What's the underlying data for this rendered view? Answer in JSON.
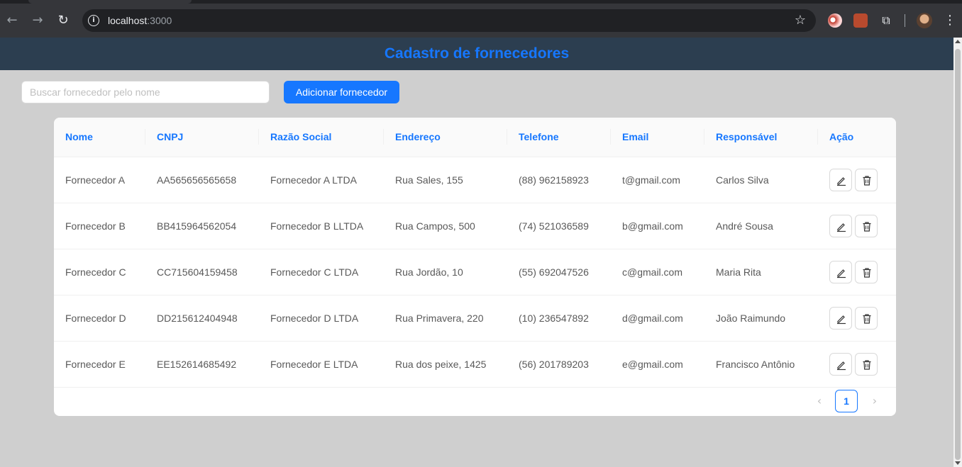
{
  "browser": {
    "url_host": "localhost",
    "url_port": ":3000"
  },
  "header": {
    "title": "Cadastro de fornecedores"
  },
  "toolbar": {
    "search_placeholder": "Buscar fornecedor pelo nome",
    "search_value": "",
    "add_label": "Adicionar fornecedor"
  },
  "table": {
    "columns": [
      "Nome",
      "CNPJ",
      "Razão Social",
      "Endereço",
      "Telefone",
      "Email",
      "Responsável",
      "Ação"
    ],
    "rows": [
      [
        "Fornecedor A",
        "AA565656565658",
        "Fornecedor A LTDA",
        "Rua Sales, 155",
        "(88) 962158923",
        "t@gmail.com",
        "Carlos Silva"
      ],
      [
        "Fornecedor B",
        "BB415964562054",
        "Fornecedor B LLTDA",
        "Rua Campos, 500",
        "(74) 521036589",
        "b@gmail.com",
        "André Sousa"
      ],
      [
        "Fornecedor C",
        "CC715604159458",
        "Fornecedor C LTDA",
        "Rua Jordão, 10",
        "(55) 692047526",
        "c@gmail.com",
        "Maria Rita"
      ],
      [
        "Fornecedor D",
        "DD215612404948",
        "Fornecedor D LTDA",
        "Rua Primavera, 220",
        "(10) 236547892",
        "d@gmail.com",
        "João Raimundo"
      ],
      [
        "Fornecedor E",
        "EE152614685492",
        "Fornecedor E LTDA",
        "Rua dos peixe, 1425",
        "(56) 201789203",
        "e@gmail.com",
        "Francisco Antônio"
      ]
    ]
  },
  "pagination": {
    "current_page": "1",
    "prev_icon": "chevron-left-icon",
    "next_icon": "chevron-right-icon"
  },
  "icons": {
    "edit": "edit-icon",
    "delete": "delete-icon"
  },
  "colors": {
    "header_bg": "#2c3e50",
    "accent": "#1677ff",
    "page_bg": "#cfcfcf"
  }
}
